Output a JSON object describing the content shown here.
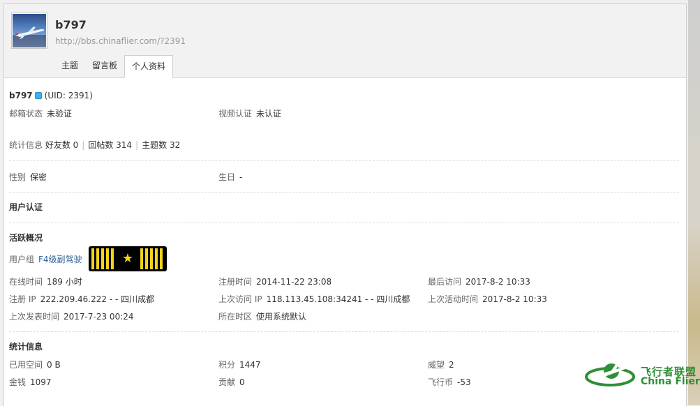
{
  "profile": {
    "username": "b797",
    "url": "http://bbs.chinaflier.com/?2391",
    "uid": "(UID: 2391)"
  },
  "tabs": [
    "主题",
    "留言板",
    "个人资料"
  ],
  "basic": {
    "email_label": "邮箱状态",
    "email_value": "未验证",
    "video_label": "视频认证",
    "video_value": "未认证"
  },
  "stats_line": {
    "label": "统计信息",
    "friends": "好友数 0",
    "replies": "回帖数 314",
    "topics": "主题数 32"
  },
  "personal": {
    "gender_label": "性别",
    "gender_value": "保密",
    "birthday_label": "生日",
    "birthday_value": "-"
  },
  "auth": {
    "title": "用户认证"
  },
  "activity": {
    "title": "活跃概况",
    "group_label": "用户组",
    "group_value": "F4级副驾驶",
    "online_label": "在线时间",
    "online_value": "189 小时",
    "reg_time_label": "注册时间",
    "reg_time_value": "2014-11-22 23:08",
    "last_visit_label": "最后访问",
    "last_visit_value": "2017-8-2 10:33",
    "reg_ip_label": "注册 IP",
    "reg_ip_value": "222.209.46.222 - - 四川成都",
    "last_ip_label": "上次访问 IP",
    "last_ip_value": "118.113.45.108:34241 - - 四川成都",
    "last_active_label": "上次活动时间",
    "last_active_value": "2017-8-2 10:33",
    "last_post_label": "上次发表时间",
    "last_post_value": "2017-7-23 00:24",
    "timezone_label": "所在时区",
    "timezone_value": "使用系统默认"
  },
  "statistics": {
    "title": "统计信息",
    "space_label": "已用空间",
    "space_value": "0 B",
    "points_label": "积分",
    "points_value": "1447",
    "prestige_label": "威望",
    "prestige_value": "2",
    "money_label": "金钱",
    "money_value": "1097",
    "contribution_label": "贡献",
    "contribution_value": "0",
    "flycoin_label": "飞行币",
    "flycoin_value": "-53"
  },
  "logo": {
    "cn": "飞行者联盟",
    "en": "China Flier"
  },
  "colors": {
    "link": "#336699",
    "online": "#39b3ee",
    "badge_gold": "#f2d418",
    "logo_green": "#2f8f35"
  },
  "icons": {
    "online_status": "online-dot-icon",
    "badge_star": "star-icon"
  }
}
